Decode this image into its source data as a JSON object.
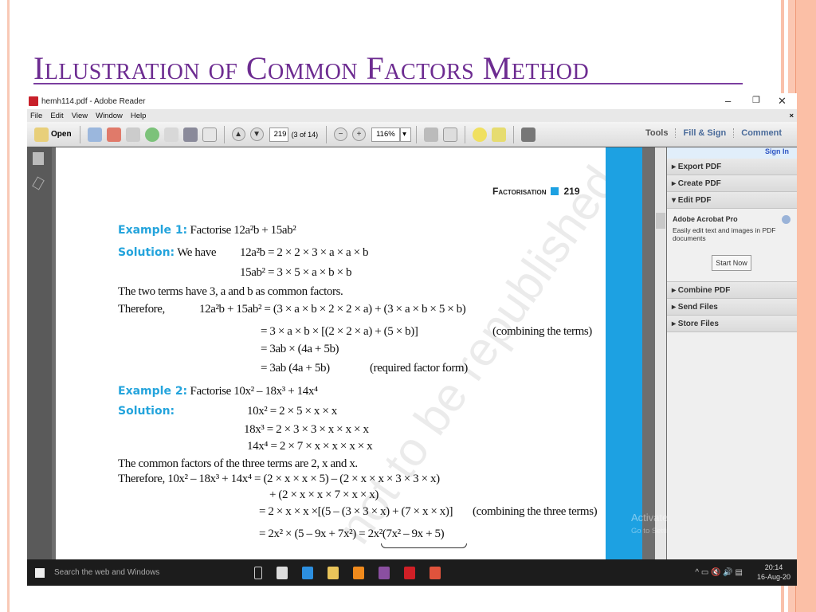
{
  "slide": {
    "title": "Illustration of Common Factors Method",
    "accent": "#6d2c91",
    "decor_color": "#f7b49a"
  },
  "window": {
    "title": "hemh114.pdf - Adobe Reader",
    "minimize": "–",
    "restore": "❐",
    "close": "✕",
    "close_doc": "×"
  },
  "menu": [
    "File",
    "Edit",
    "View",
    "Window",
    "Help"
  ],
  "toolbar": {
    "open": "Open",
    "page_number": "219",
    "page_count": "(3 of 14)",
    "zoom": "116%",
    "zoom_arrow": "▾",
    "prev": "▲",
    "next": "▼",
    "zoom_out": "−",
    "zoom_in": "+",
    "right_links": [
      "Tools",
      "Fill & Sign",
      "Comment"
    ]
  },
  "right_pane": {
    "sign_in": "Sign In",
    "sections_top": [
      "▸ Export PDF",
      "▸ Create PDF",
      "▾ Edit PDF"
    ],
    "edit_title": "Adobe Acrobat Pro",
    "edit_desc": "Easily edit text and images in PDF documents",
    "start_now": "Start Now",
    "sections_bottom": [
      "▸ Combine PDF",
      "▸ Send Files",
      "▸ Store Files"
    ]
  },
  "page": {
    "header_text": "Factorisation",
    "header_num": "219",
    "ex1_label": "Example 1:",
    "ex1_text": "Factorise  12a²b + 15ab²",
    "sol1_label": "Solution:",
    "sol1_text": "We have",
    "ex1_lines": [
      "12a²b = 2 × 2 × 3 × a × a × b",
      "15ab² = 3 × 5 × a × b × b",
      "The two terms have 3, a and b as common factors.",
      "Therefore,",
      "12a²b + 15ab² = (3 × a × b × 2 × 2 × a) + (3 × a × b × 5 × b)",
      "= 3 × a × b × [(2 × 2 × a) + (5 × b)]",
      "(combining the terms)",
      "= 3ab × (4a + 5b)",
      "= 3ab (4a + 5b)",
      "(required factor form)"
    ],
    "ex2_label": "Example 2:",
    "ex2_text": "Factorise 10x² – 18x³ + 14x⁴",
    "sol2_label": "Solution:",
    "ex2_lines": [
      "10x² = 2 × 5 × x × x",
      "18x³ = 2 × 3 × 3 × x × x × x",
      "14x⁴ = 2 × 7 × x × x × x × x",
      "The common factors of the three terms are 2, x and x.",
      "Therefore, 10x² – 18x³ + 14x⁴ = (2 × x × x × 5) – (2 × x × x × 3 × 3 × x)",
      "+ (2 × x × x × 7 × x × x)",
      "= 2 × x × x ×[(5 – (3 × 3 × x) + (7 × x × x)]",
      "(combining the three terms)",
      "= 2x² × (5 – 9x + 7x²) = 2x²(7x² – 9x + 5)"
    ],
    "watermark": "not to be republished"
  },
  "activation": {
    "title": "Activate Windows",
    "subtitle": "Go to Settings to activate Windows."
  },
  "taskbar": {
    "search": "Search the web and Windows",
    "time": "20:14",
    "date": "16-Aug-20",
    "tray": "^ ▭ 🔇 🔊 ▤"
  }
}
